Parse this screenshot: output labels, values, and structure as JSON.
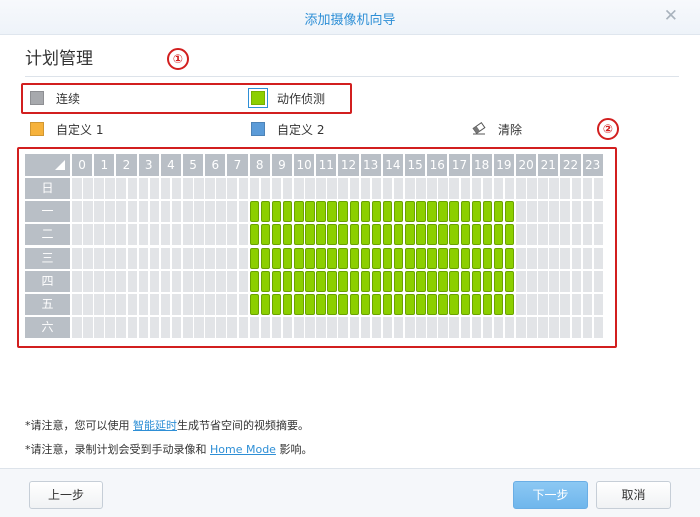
{
  "dialog": {
    "title": "添加摄像机向导",
    "close_glyph": "✕"
  },
  "section": {
    "title": "计划管理"
  },
  "annotations": {
    "one": "①",
    "two": "②"
  },
  "legend": {
    "continuous": {
      "label": "连续",
      "color": "#a7a9ad"
    },
    "motion": {
      "label": "动作侦测",
      "color": "#8ccf00"
    },
    "custom1": {
      "label": "自定义 1",
      "color": "#f6b23b"
    },
    "custom2": {
      "label": "自定义 2",
      "color": "#5b9bd8"
    },
    "clear": {
      "label": "清除",
      "icon": "eraser-icon"
    }
  },
  "schedule": {
    "hours": [
      "0",
      "1",
      "2",
      "3",
      "4",
      "5",
      "6",
      "7",
      "8",
      "9",
      "10",
      "11",
      "12",
      "13",
      "14",
      "15",
      "16",
      "17",
      "18",
      "19",
      "20",
      "21",
      "22",
      "23"
    ],
    "days": [
      "日",
      "一",
      "二",
      "三",
      "四",
      "五",
      "六"
    ],
    "motion_detection_days": [
      "一",
      "二",
      "三",
      "四",
      "五"
    ],
    "motion_detection_start": "8:00",
    "motion_detection_end": "20:00"
  },
  "notes": {
    "line1_prefix": "*请注意，您可以使用 ",
    "line1_link": "智能延时",
    "line1_suffix": "生成节省空间的视频摘要。",
    "line2_prefix": "*请注意，录制计划会受到手动录像和 ",
    "line2_link": "Home Mode",
    "line2_suffix": " 影响。"
  },
  "footer": {
    "prev": "上一步",
    "next": "下一步",
    "cancel": "取消"
  }
}
